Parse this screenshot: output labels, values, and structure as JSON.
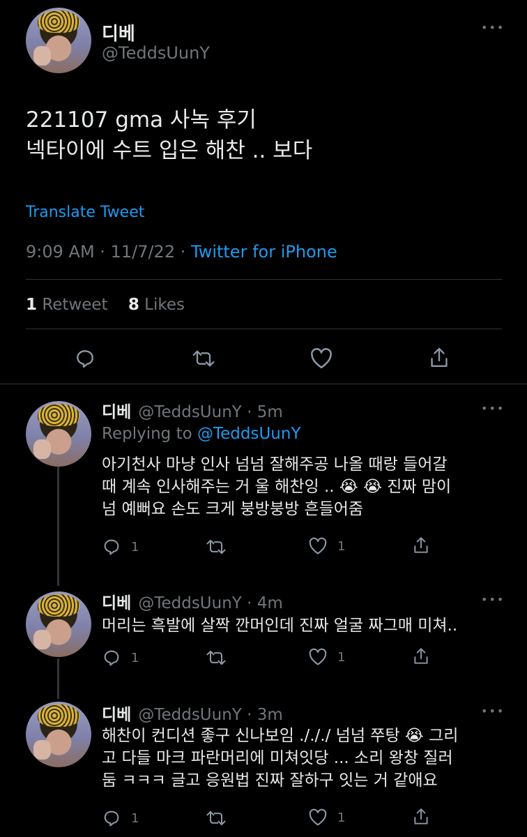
{
  "main_tweet": {
    "display_name": "디베",
    "handle": "@TeddsUunY",
    "text_lines": [
      "221107 gma 사녹 후기",
      "넥타이에 수트 입은 해찬 .. 보다"
    ],
    "translate_label": "Translate Tweet",
    "time": "9:09 AM",
    "date": "11/7/22",
    "source": "Twitter for iPhone",
    "retweets_count": "1",
    "retweets_label": "Retweet",
    "likes_count": "8",
    "likes_label": "Likes",
    "more_icon": "more-dots-icon"
  },
  "replies": [
    {
      "display_name": "디베",
      "handle_time": "@TeddsUunY · 5m",
      "replying_prefix": "Replying to",
      "replying_handle": "@TeddsUunY",
      "text_lines": [
        "아기천사 마냥 인사 넘넘 잘해주공 나올 때랑 들어갈",
        "때 계속 인사해주는 거 울 해찬잉 .. 😭 😭 진짜 맘이",
        "넘 예뻐요 손도 크게 붕방붕방 흔들어줌"
      ],
      "reply_count": "1",
      "like_count": "1"
    },
    {
      "display_name": "디베",
      "handle_time": "@TeddsUunY · 4m",
      "text_lines": [
        "머리는 흑발에 살짝 깐머인데 진짜 얼굴 짜그매 미쳐.."
      ],
      "reply_count": "1",
      "like_count": "1"
    },
    {
      "display_name": "디베",
      "handle_time": "@TeddsUunY · 3m",
      "text_lines": [
        "해찬이 컨디션 좋구 신나보임 ./././ 넘넘 쭈탕 😭 그리",
        "고 다들 마크 파란머리에 미쳐잇당 ... 소리 왕창 질러",
        "둠 ㅋㅋㅋ 글고 응원법 진짜 잘하구 잇는 거 같애요"
      ],
      "reply_count": "1",
      "like_count": "1"
    }
  ],
  "colors": {
    "background": "#000000",
    "text": "#e7e9ea",
    "muted": "#71767b",
    "accent": "#1d9bf0",
    "divider": "#2f3336"
  }
}
